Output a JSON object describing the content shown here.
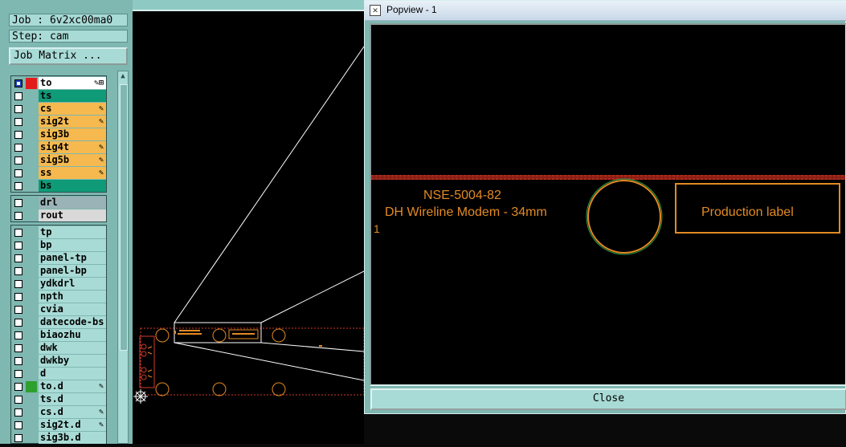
{
  "job": {
    "label": "Job : 6v2xc00ma0",
    "step": "Step: cam"
  },
  "job_matrix_button": "Job Matrix ...",
  "layers": [
    {
      "name": "to",
      "bg": "#ffffff",
      "swatch": "#e21b1b",
      "checked": true,
      "mark": "✎⊞"
    },
    {
      "name": "ts",
      "bg": "#0f9a78",
      "swatch": "",
      "checked": false,
      "mark": ""
    },
    {
      "name": "cs",
      "bg": "#f5b94f",
      "swatch": "",
      "checked": false,
      "mark": "✎"
    },
    {
      "name": "sig2t",
      "bg": "#f5b94f",
      "swatch": "",
      "checked": false,
      "mark": "✎"
    },
    {
      "name": "sig3b",
      "bg": "#f5b94f",
      "swatch": "",
      "checked": false,
      "mark": ""
    },
    {
      "name": "sig4t",
      "bg": "#f5b94f",
      "swatch": "",
      "checked": false,
      "mark": "✎"
    },
    {
      "name": "sig5b",
      "bg": "#f5b94f",
      "swatch": "",
      "checked": false,
      "mark": "✎"
    },
    {
      "name": "ss",
      "bg": "#f5b94f",
      "swatch": "",
      "checked": false,
      "mark": "✎"
    },
    {
      "name": "bs",
      "bg": "#0f9a78",
      "swatch": "",
      "checked": false,
      "mark": ""
    }
  ],
  "drill_layers": [
    {
      "name": "drl",
      "bg": "#9ab3b6",
      "swatch": "",
      "checked": false,
      "mark": ""
    },
    {
      "name": "rout",
      "bg": "#d9d9d9",
      "swatch": "",
      "checked": false,
      "mark": ""
    }
  ],
  "misc_layers": [
    {
      "name": "tp",
      "bg": "#a9dbd6",
      "swatch": "",
      "checked": false,
      "mark": ""
    },
    {
      "name": "bp",
      "bg": "#a9dbd6",
      "swatch": "",
      "checked": false,
      "mark": ""
    },
    {
      "name": "panel-tp",
      "bg": "#a9dbd6",
      "swatch": "",
      "checked": false,
      "mark": ""
    },
    {
      "name": "panel-bp",
      "bg": "#a9dbd6",
      "swatch": "",
      "checked": false,
      "mark": ""
    },
    {
      "name": "ydkdrl",
      "bg": "#a9dbd6",
      "swatch": "",
      "checked": false,
      "mark": ""
    },
    {
      "name": "npth",
      "bg": "#a9dbd6",
      "swatch": "",
      "checked": false,
      "mark": ""
    },
    {
      "name": "cvia",
      "bg": "#a9dbd6",
      "swatch": "",
      "checked": false,
      "mark": ""
    },
    {
      "name": "datecode-bs",
      "bg": "#a9dbd6",
      "swatch": "",
      "checked": false,
      "mark": ""
    },
    {
      "name": "biaozhu",
      "bg": "#a9dbd6",
      "swatch": "",
      "checked": false,
      "mark": ""
    },
    {
      "name": "dwk",
      "bg": "#a9dbd6",
      "swatch": "",
      "checked": false,
      "mark": ""
    },
    {
      "name": "dwkby",
      "bg": "#a9dbd6",
      "swatch": "",
      "checked": false,
      "mark": ""
    },
    {
      "name": "d",
      "bg": "#a9dbd6",
      "swatch": "",
      "checked": false,
      "mark": ""
    },
    {
      "name": "to.d",
      "bg": "#a9dbd6",
      "swatch": "#2ea02e",
      "checked": false,
      "mark": "✎"
    },
    {
      "name": "ts.d",
      "bg": "#a9dbd6",
      "swatch": "",
      "checked": false,
      "mark": ""
    },
    {
      "name": "cs.d",
      "bg": "#a9dbd6",
      "swatch": "",
      "checked": false,
      "mark": "✎"
    },
    {
      "name": "sig2t.d",
      "bg": "#a9dbd6",
      "swatch": "",
      "checked": false,
      "mark": "✎"
    },
    {
      "name": "sig3b.d",
      "bg": "#a9dbd6",
      "swatch": "",
      "checked": false,
      "mark": ""
    }
  ],
  "popview": {
    "title": "Popview - 1",
    "line1": "NSE-5004-82",
    "line2": "DH Wireline Modem - 34mm",
    "marker": "1",
    "production_label": "Production label",
    "close_label": "Close"
  },
  "colors": {
    "panel": "#7fb7b1",
    "panel_light": "#a9dbd6",
    "graphic_text": "#e28a23",
    "outline_red": "#d23a2a"
  },
  "icons": [
    "popview-window-icon",
    "edit-pencil-icon",
    "crosshair-icon",
    "scroll-up-arrow-icon"
  ]
}
